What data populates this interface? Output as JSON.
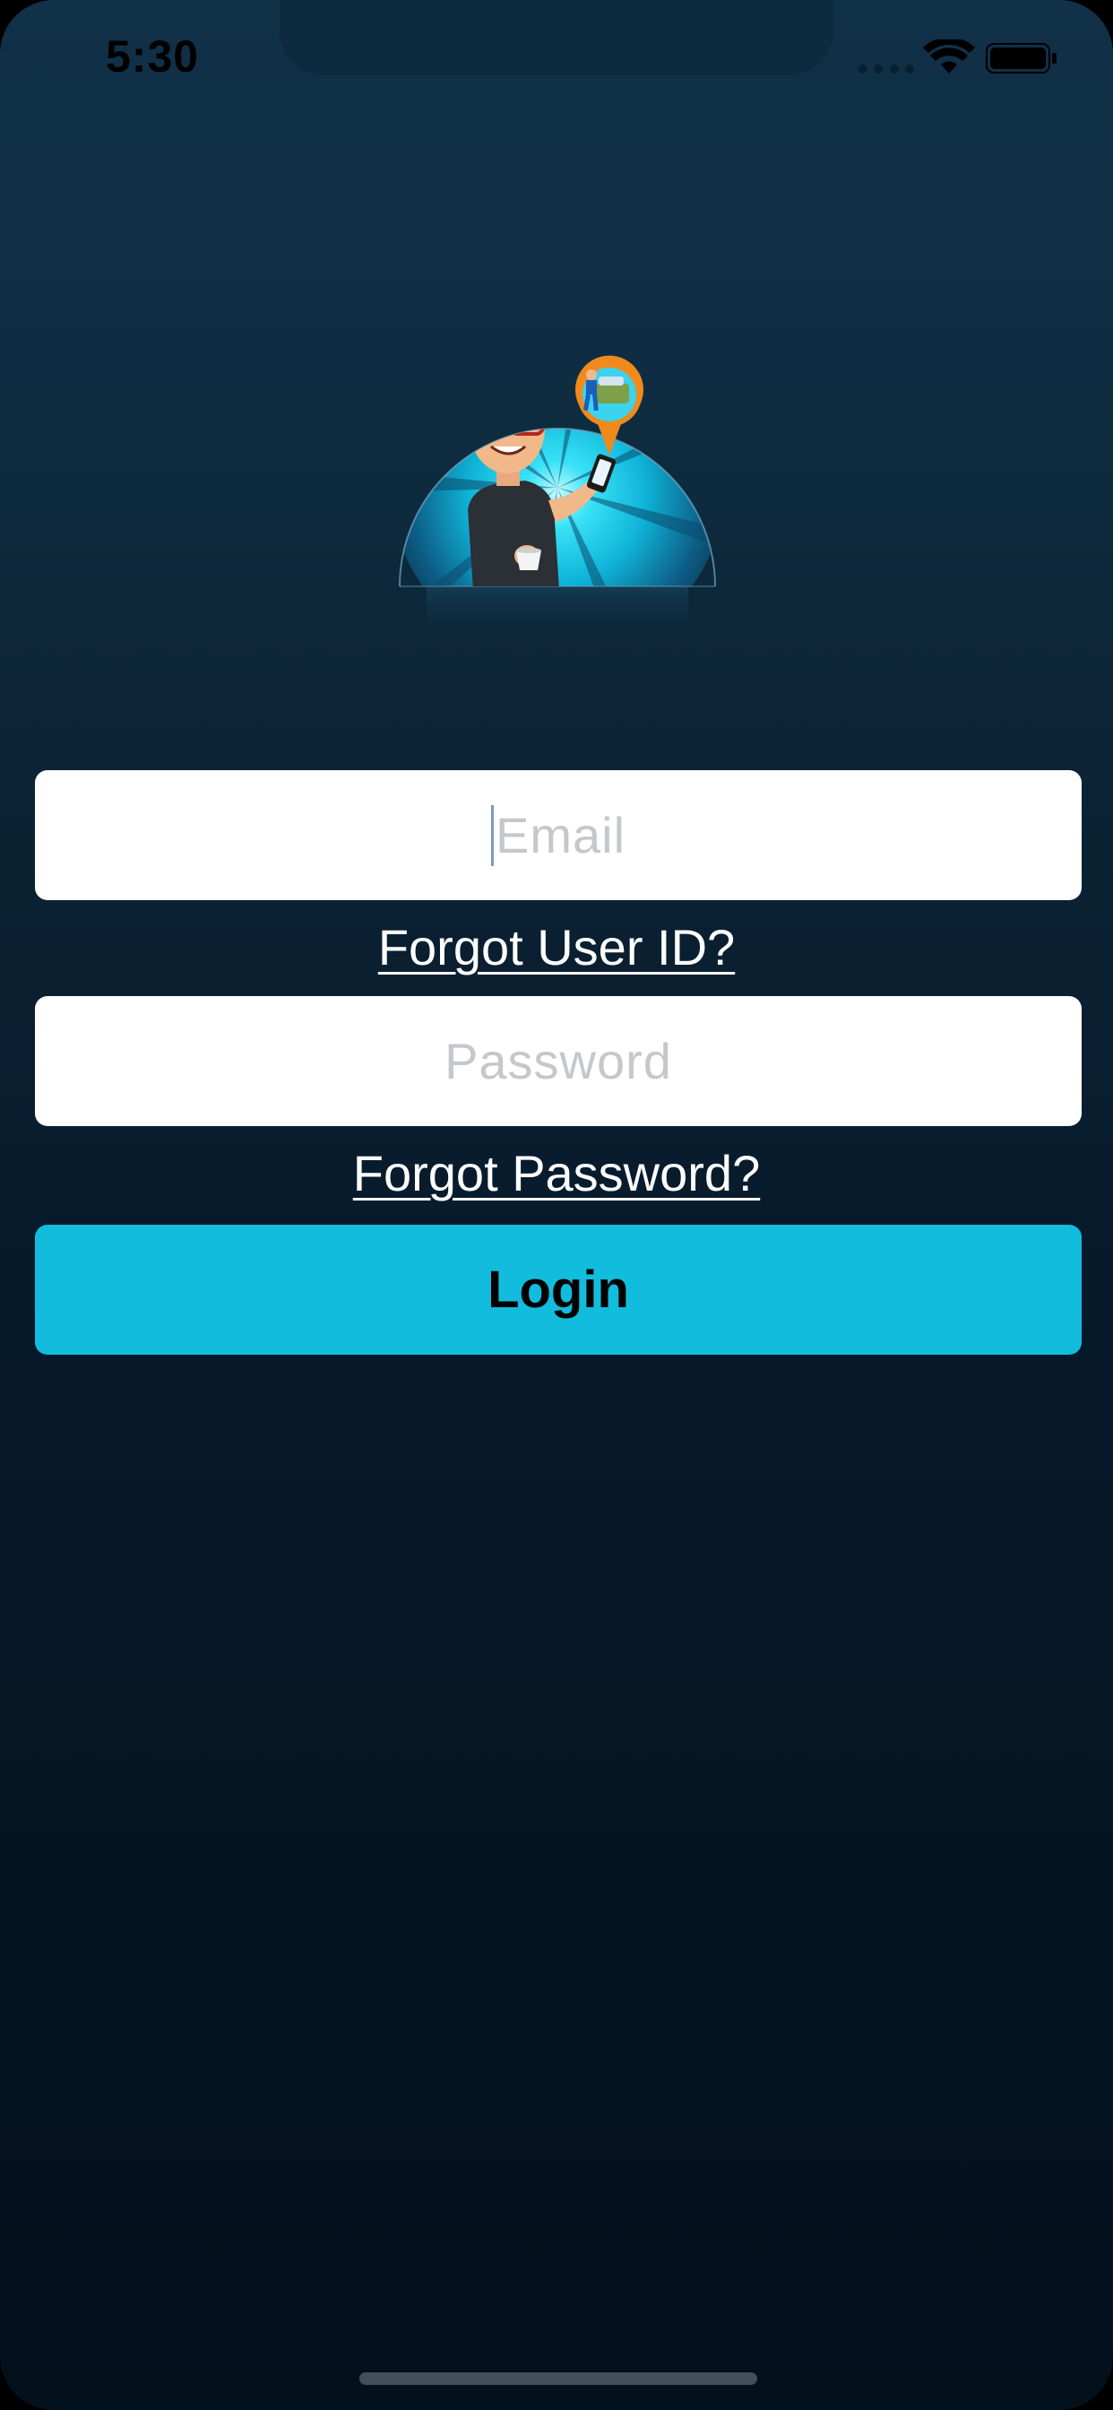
{
  "status_bar": {
    "time": "5:30"
  },
  "hero": {
    "icon": "mechanic-locator-illustration"
  },
  "login_form": {
    "email_placeholder": "Email",
    "forgot_user_id_label": "Forgot User ID?",
    "password_placeholder": "Password",
    "forgot_password_label": "Forgot Password?",
    "login_label": "Login"
  },
  "colors": {
    "accent": "#12bcdc",
    "background_top": "#113148",
    "background_bottom": "#03111d",
    "field_background": "#ffffff",
    "placeholder": "#c6c7cc"
  }
}
